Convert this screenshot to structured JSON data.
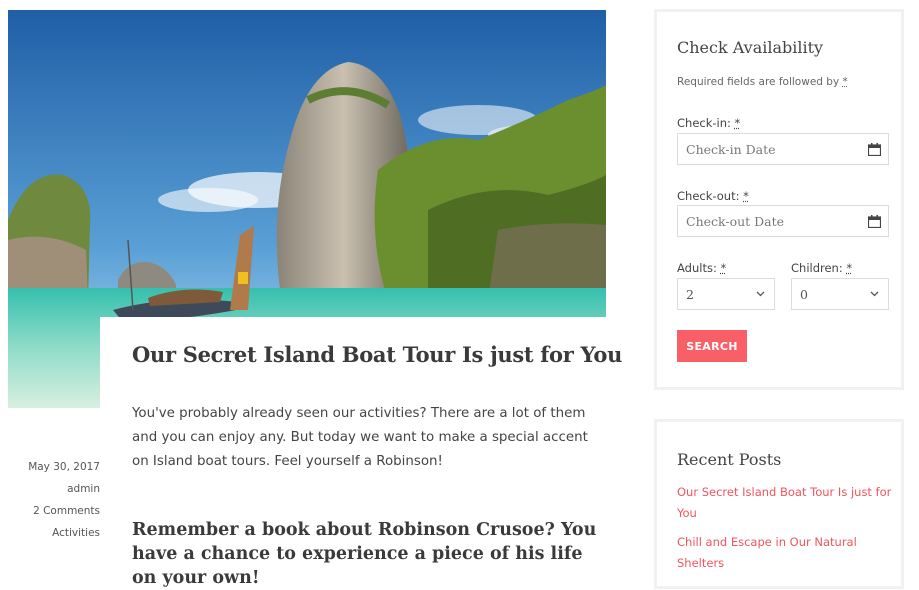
{
  "post": {
    "image_alt": "Tropical island cliffs with longtail boat",
    "title": "Our Secret Island Boat Tour Is just for You",
    "excerpt": "You've probably already seen our activities? There are a lot of them and you can enjoy any. But today we want to make a special accent on Island boat tours. Feel yourself a Robinson!",
    "subheading": "Remember a book about Robinson Crusoe? You have a chance to experience a piece of his life on your own!",
    "meta": {
      "date": "May 30, 2017",
      "author": "admin",
      "comments": "2 Comments",
      "category": "Activities"
    }
  },
  "availability": {
    "title": "Check Availability",
    "required_note": "Required fields are followed by",
    "required_mark": "*",
    "checkin_label": "Check-in:",
    "checkin_placeholder": "Check-in Date",
    "checkout_label": "Check-out:",
    "checkout_placeholder": "Check-out Date",
    "adults_label": "Adults:",
    "adults_value": "2",
    "children_label": "Children:",
    "children_value": "0",
    "search_label": "SEARCH",
    "calendar_icon": "calendar-icon",
    "chevron_icon": "chevron-down-icon"
  },
  "recent_posts": {
    "title": "Recent Posts",
    "items": [
      "Our Secret Island Boat Tour Is just for You",
      "Chill and Escape in Our Natural Shelters"
    ]
  },
  "colors": {
    "accent": "#f95f67",
    "link": "#f0555d",
    "widget_border": "#f1f1f1"
  }
}
